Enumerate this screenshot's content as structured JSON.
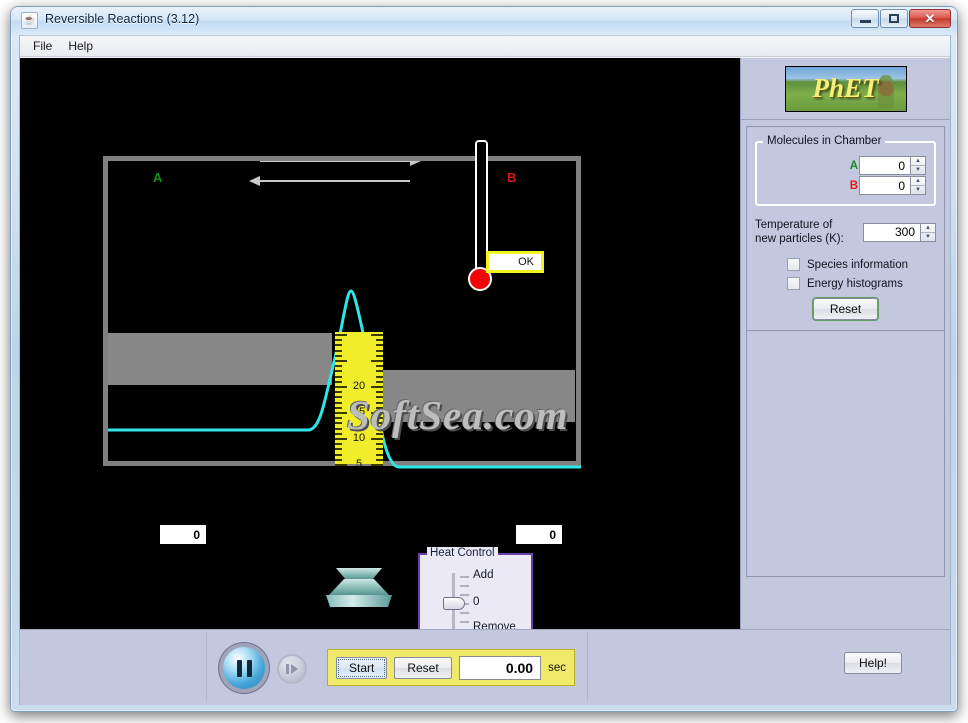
{
  "window": {
    "title": "Reversible Reactions (3.12)",
    "icon": "java-coffee-icon",
    "minimize": "minimize-icon",
    "maximize": "maximize-icon",
    "close": "✕"
  },
  "menubar": {
    "items": [
      {
        "label": "File"
      },
      {
        "label": "Help"
      }
    ]
  },
  "canvas": {
    "species_a_label": "A",
    "species_b_label": "B",
    "arrow_forward": "forward-reaction-arrow",
    "arrow_reverse": "reverse-reaction-arrow",
    "thermometer_readout": "OK",
    "counter_a": "0",
    "counter_b": "0",
    "watermark": "SoftSea.com",
    "ruler_labels": [
      "20",
      "15",
      "10",
      "5"
    ],
    "heat_control": {
      "title": "Heat Control",
      "add_label": "Add",
      "zero_label": "0",
      "remove_label": "Remove"
    }
  },
  "right_panel": {
    "logo_text": "PhET",
    "molecules_group": {
      "title": "Molecules in Chamber",
      "a_letter": "A",
      "a_value": "0",
      "b_letter": "B",
      "b_value": "0"
    },
    "temperature": {
      "label_line1": "Temperature of",
      "label_line2": "new particles (K):",
      "value": "300"
    },
    "checkboxes": [
      {
        "label": "Species information",
        "checked": false
      },
      {
        "label": "Energy histograms",
        "checked": false
      }
    ],
    "reset_button": "Reset"
  },
  "bottom_bar": {
    "play_pause": "pause-icon",
    "step": "step-forward-icon",
    "start_button": "Start",
    "reset_button": "Reset",
    "time_value": "0.00",
    "time_unit": "sec",
    "help_button": "Help!"
  },
  "colors": {
    "species_a": "#0f8f18",
    "species_b": "#e01010",
    "panel_bg": "#c4c8de",
    "canvas_bg": "#000000",
    "ruler": "#f2ed2b",
    "curve": "#2ee6e6",
    "clock_panel": "#f0e96a"
  }
}
